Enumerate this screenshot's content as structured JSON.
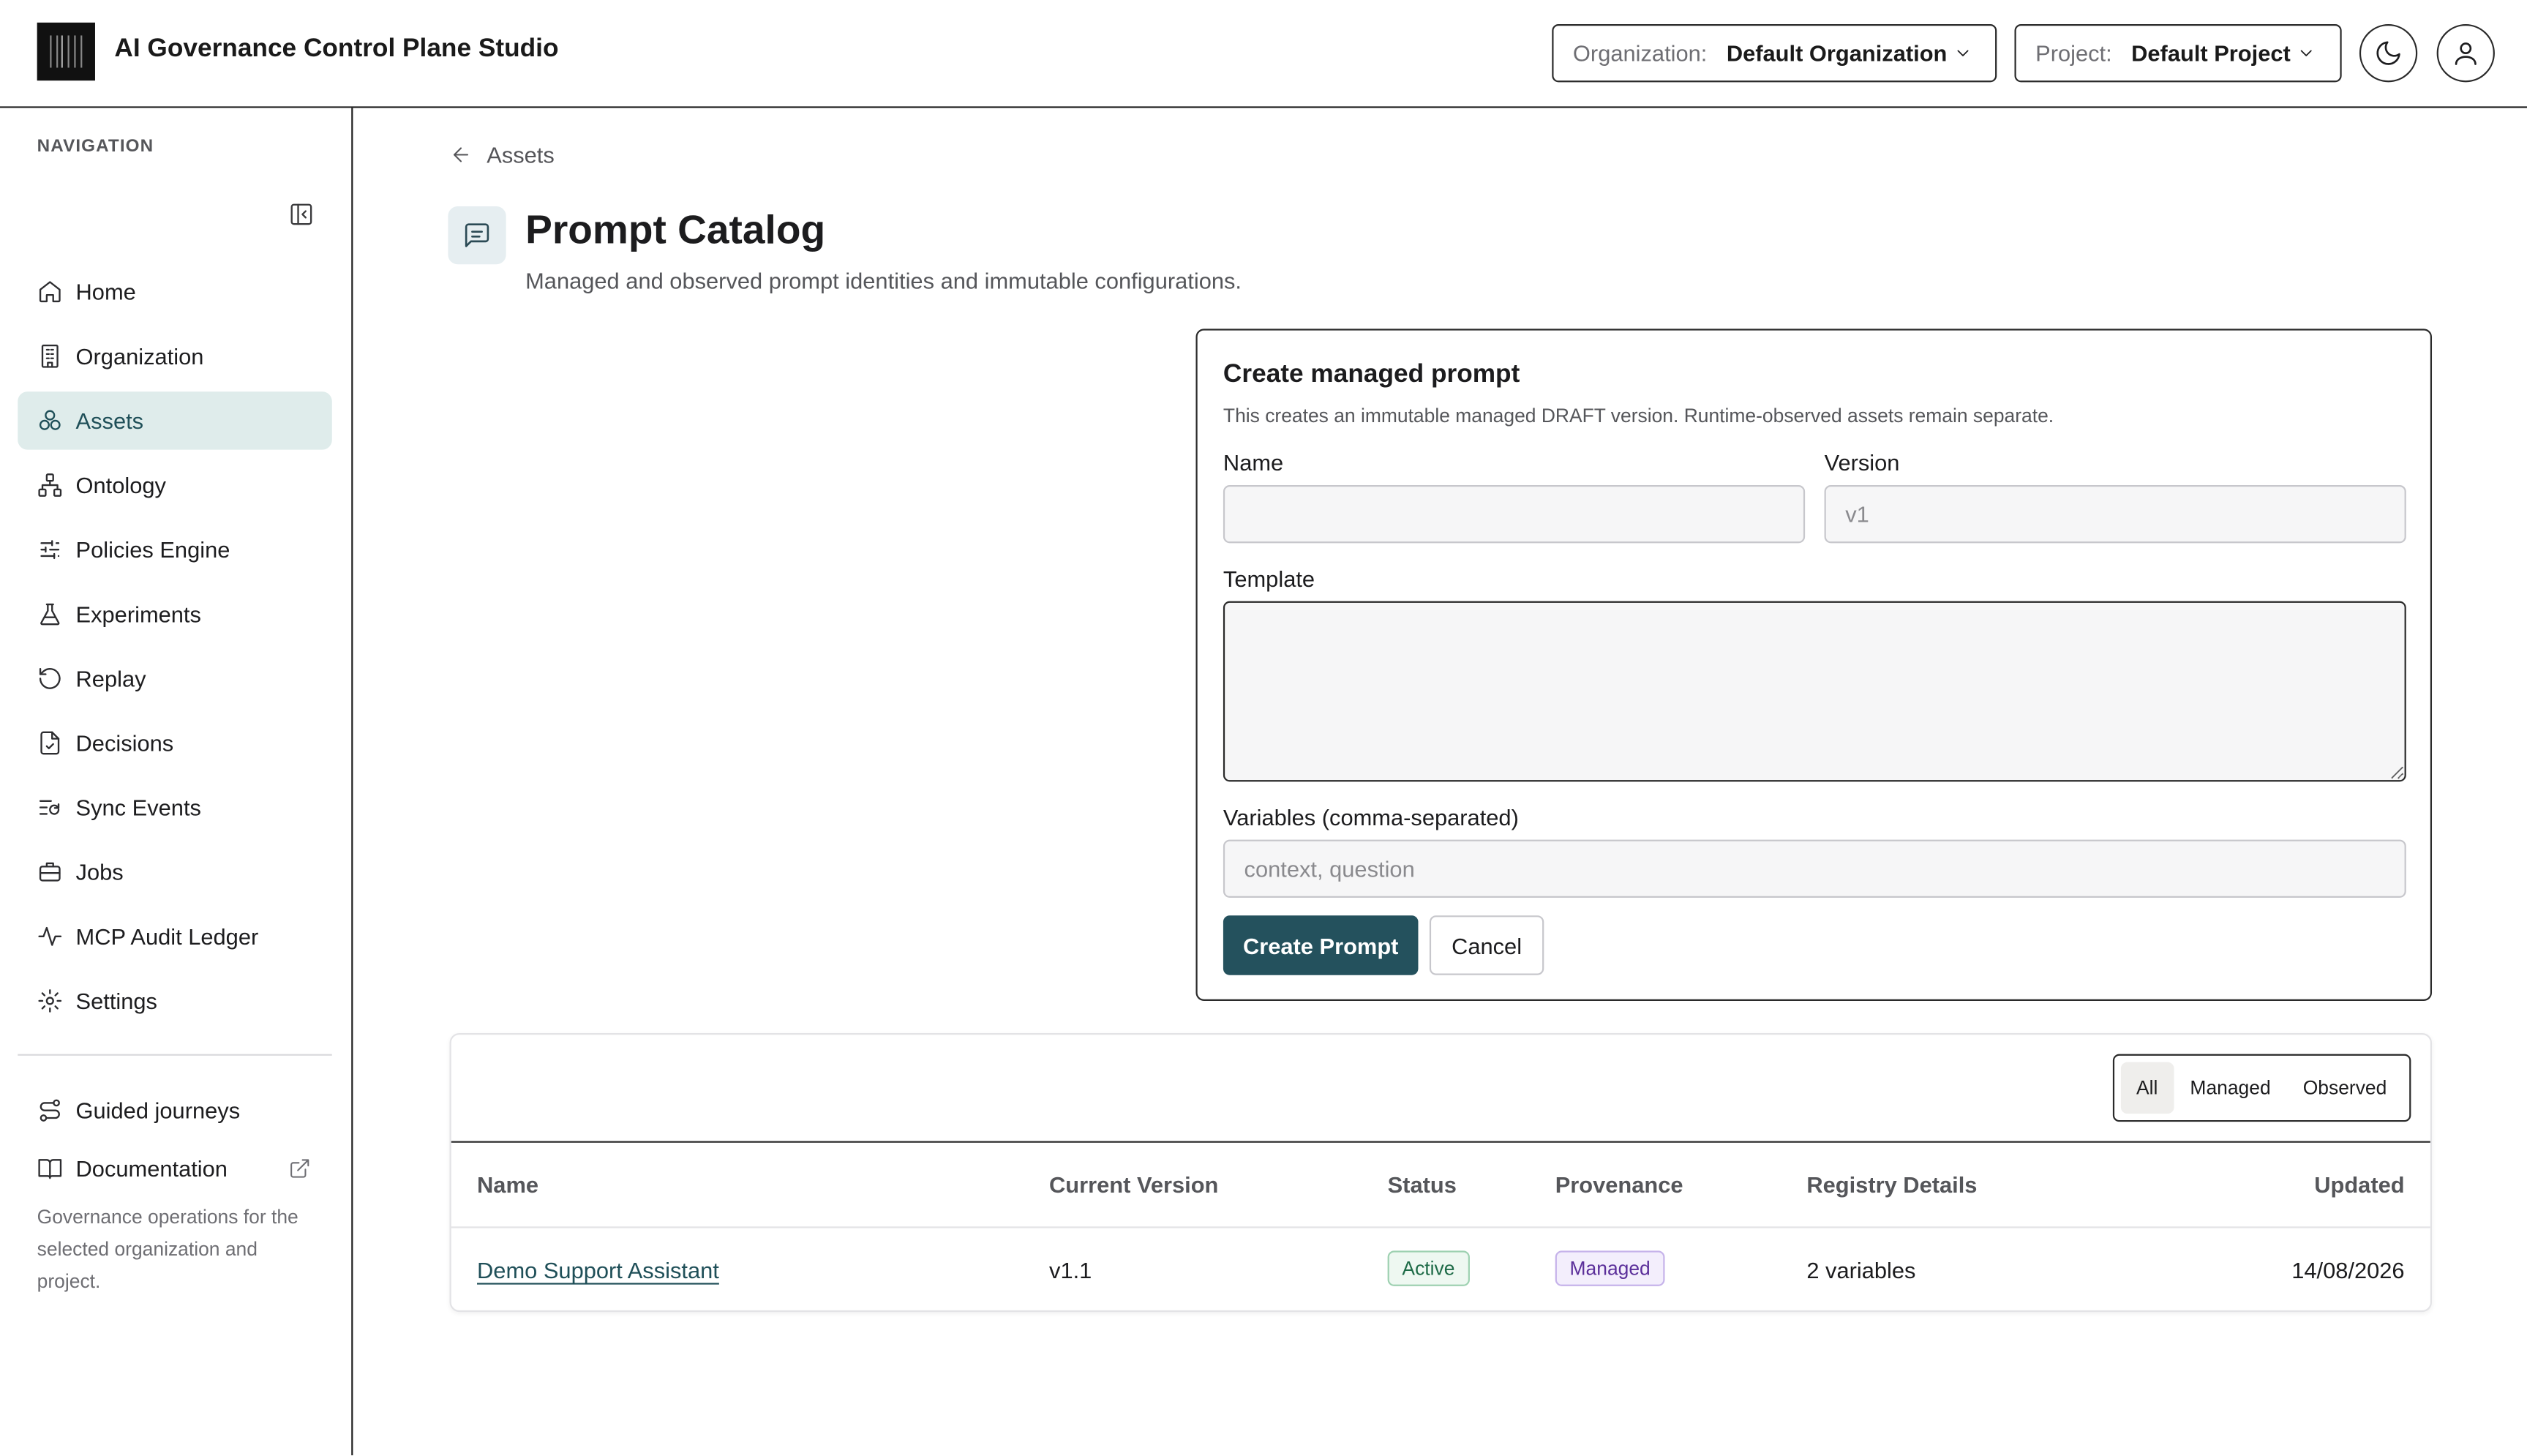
{
  "app": {
    "title": "AI Governance Control Plane Studio"
  },
  "header": {
    "organization_label": "Organization:",
    "organization_value": "Default Organization",
    "project_label": "Project:",
    "project_value": "Default Project"
  },
  "sidebar": {
    "heading": "NAVIGATION",
    "items": [
      {
        "label": "Home",
        "icon": "home-icon"
      },
      {
        "label": "Organization",
        "icon": "building-icon"
      },
      {
        "label": "Assets",
        "icon": "assets-icon",
        "active": true
      },
      {
        "label": "Ontology",
        "icon": "network-icon"
      },
      {
        "label": "Policies Engine",
        "icon": "sliders-icon"
      },
      {
        "label": "Experiments",
        "icon": "flask-icon"
      },
      {
        "label": "Replay",
        "icon": "replay-icon"
      },
      {
        "label": "Decisions",
        "icon": "decision-file-icon"
      },
      {
        "label": "Sync Events",
        "icon": "sync-icon"
      },
      {
        "label": "Jobs",
        "icon": "briefcase-icon"
      },
      {
        "label": "MCP Audit Ledger",
        "icon": "activity-icon"
      },
      {
        "label": "Settings",
        "icon": "gear-icon"
      }
    ],
    "guided_journeys": "Guided journeys",
    "documentation": "Documentation",
    "footer_text": "Governance operations for the selected organization and project."
  },
  "breadcrumb": {
    "back_label": "Assets"
  },
  "page": {
    "title": "Prompt Catalog",
    "subtitle": "Managed and observed prompt identities and immutable configurations."
  },
  "form": {
    "title": "Create managed prompt",
    "description": "This creates an immutable managed DRAFT version. Runtime-observed assets remain separate.",
    "name_label": "Name",
    "name_value": "",
    "version_label": "Version",
    "version_placeholder": "v1",
    "template_label": "Template",
    "template_value": "",
    "variables_label": "Variables (comma-separated)",
    "variables_placeholder": "context, question",
    "submit_label": "Create Prompt",
    "cancel_label": "Cancel"
  },
  "filter": {
    "options": [
      "All",
      "Managed",
      "Observed"
    ],
    "selected": "All"
  },
  "table": {
    "columns": [
      "Name",
      "Current Version",
      "Status",
      "Provenance",
      "Registry Details",
      "Updated"
    ],
    "rows": [
      {
        "name": "Demo Support Assistant",
        "version": "v1.1",
        "status": "Active",
        "provenance": "Managed",
        "details": "2 variables",
        "updated": "14/08/2026"
      }
    ]
  },
  "colors": {
    "accent": "#24515d",
    "active_nav_bg": "#dfeceb",
    "status_active": "#1e6b47",
    "provenance_managed": "#5b2f9a"
  }
}
